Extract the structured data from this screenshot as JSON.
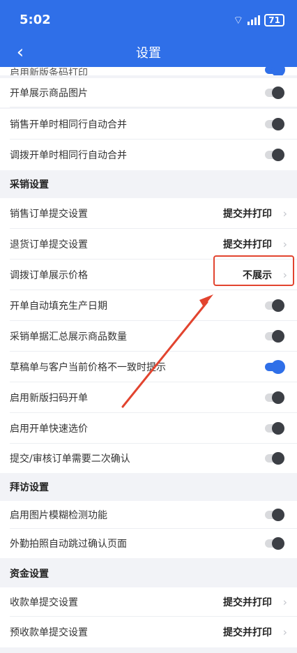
{
  "status": {
    "time": "5:02",
    "battery": "71"
  },
  "nav": {
    "title": "设置"
  },
  "rows": {
    "r0": "启用新版条码打印",
    "r1": "开单展示商品图片",
    "r2": "销售开单时相同行自动合并",
    "r3": "调拨开单时相同行自动合并",
    "s1": "采销设置",
    "r4": "销售订单提交设置",
    "r4v": "提交并打印",
    "r5": "退货订单提交设置",
    "r5v": "提交并打印",
    "r6": "调拨订单展示价格",
    "r6v": "不展示",
    "r7": "开单自动填充生产日期",
    "r8": "采销单据汇总展示商品数量",
    "r9": "草稿单与客户当前价格不一致时提示",
    "r10": "启用新版扫码开单",
    "r11": "启用开单快速选价",
    "r12": "提交/审核订单需要二次确认",
    "s2": "拜访设置",
    "r13": "启用图片模糊检测功能",
    "r14": "外勤拍照自动跳过确认页面",
    "s3": "资金设置",
    "r15": "收款单提交设置",
    "r15v": "提交并打印",
    "r16": "预收款单提交设置",
    "r16v": "提交并打印"
  },
  "icons": {
    "back": "back-chevron-icon",
    "wifi": "wifi-icon",
    "signal": "signal-icon",
    "battery": "battery-icon",
    "chevron": "chevron-right-icon"
  },
  "colors": {
    "primary": "#2f6fe8",
    "annotation": "#e2442f"
  }
}
